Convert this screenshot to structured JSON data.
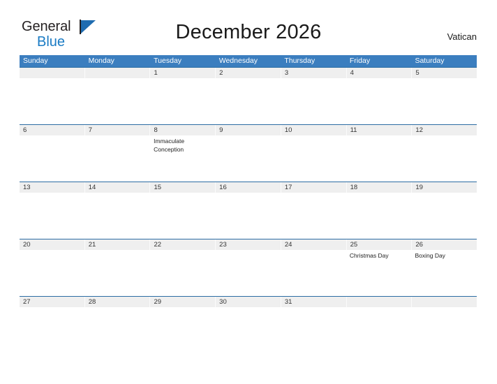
{
  "brand": {
    "name_part1": "General",
    "name_part2": "Blue"
  },
  "header": {
    "title": "December 2026",
    "country": "Vatican"
  },
  "calendar": {
    "weekdays": [
      "Sunday",
      "Monday",
      "Tuesday",
      "Wednesday",
      "Thursday",
      "Friday",
      "Saturday"
    ],
    "accent_color": "#3b7ebf",
    "date_strip_color": "#efefef",
    "weeks": [
      {
        "days": [
          {
            "date": "",
            "event": ""
          },
          {
            "date": "",
            "event": ""
          },
          {
            "date": "1",
            "event": ""
          },
          {
            "date": "2",
            "event": ""
          },
          {
            "date": "3",
            "event": ""
          },
          {
            "date": "4",
            "event": ""
          },
          {
            "date": "5",
            "event": ""
          }
        ]
      },
      {
        "days": [
          {
            "date": "6",
            "event": ""
          },
          {
            "date": "7",
            "event": ""
          },
          {
            "date": "8",
            "event": "Immaculate Conception"
          },
          {
            "date": "9",
            "event": ""
          },
          {
            "date": "10",
            "event": ""
          },
          {
            "date": "11",
            "event": ""
          },
          {
            "date": "12",
            "event": ""
          }
        ]
      },
      {
        "days": [
          {
            "date": "13",
            "event": ""
          },
          {
            "date": "14",
            "event": ""
          },
          {
            "date": "15",
            "event": ""
          },
          {
            "date": "16",
            "event": ""
          },
          {
            "date": "17",
            "event": ""
          },
          {
            "date": "18",
            "event": ""
          },
          {
            "date": "19",
            "event": ""
          }
        ]
      },
      {
        "days": [
          {
            "date": "20",
            "event": ""
          },
          {
            "date": "21",
            "event": ""
          },
          {
            "date": "22",
            "event": ""
          },
          {
            "date": "23",
            "event": ""
          },
          {
            "date": "24",
            "event": ""
          },
          {
            "date": "25",
            "event": "Christmas Day"
          },
          {
            "date": "26",
            "event": "Boxing Day"
          }
        ]
      },
      {
        "days": [
          {
            "date": "27",
            "event": ""
          },
          {
            "date": "28",
            "event": ""
          },
          {
            "date": "29",
            "event": ""
          },
          {
            "date": "30",
            "event": ""
          },
          {
            "date": "31",
            "event": ""
          },
          {
            "date": "",
            "event": ""
          },
          {
            "date": "",
            "event": ""
          }
        ]
      }
    ]
  }
}
